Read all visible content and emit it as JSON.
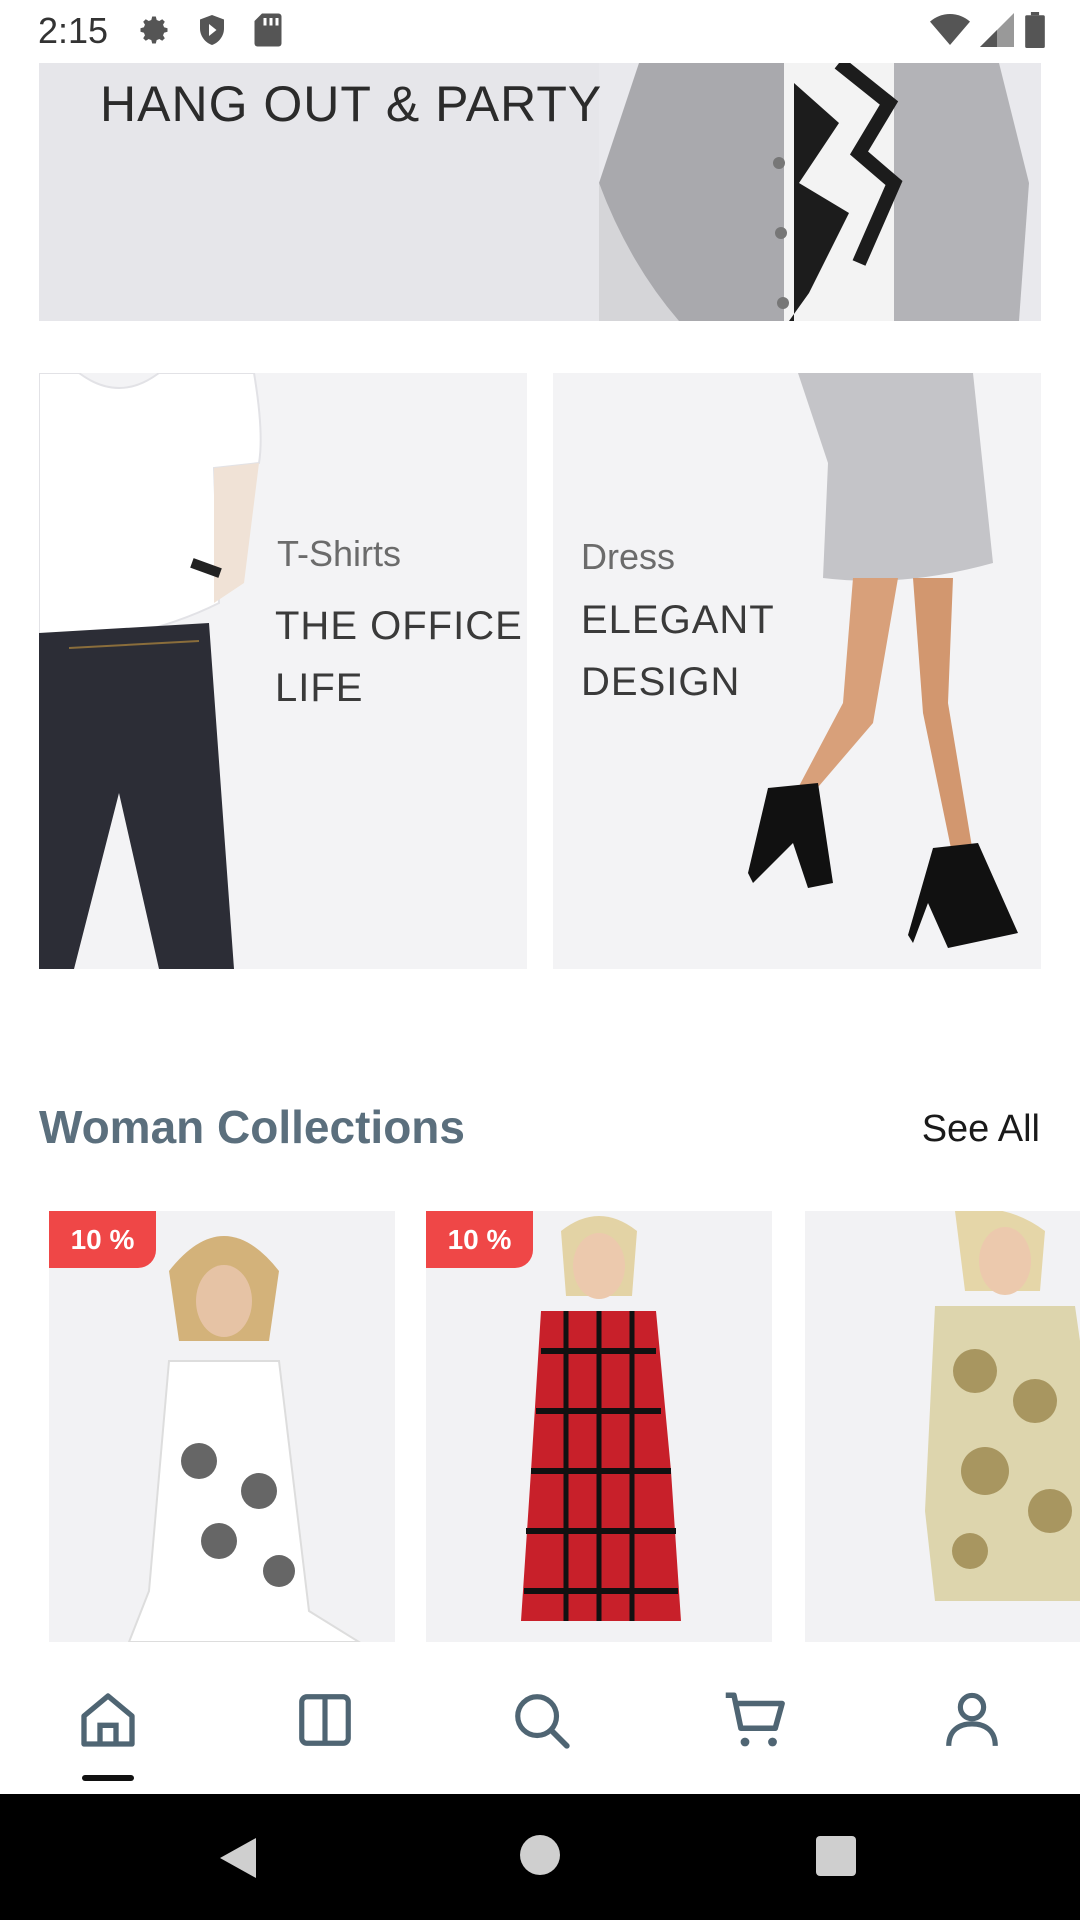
{
  "status_bar": {
    "time": "2:15",
    "left_icons": [
      "gear-icon",
      "shield-icon",
      "sd-card-icon"
    ],
    "right_icons": [
      "wifi-icon",
      "cell-signal-icon",
      "battery-icon"
    ]
  },
  "hero": {
    "title": "HANG OUT & PARTY"
  },
  "categories": [
    {
      "subtitle": "T-Shirts",
      "title_line1": "THE OFFICE",
      "title_line2": "LIFE"
    },
    {
      "subtitle": "Dress",
      "title_line1": "ELEGANT",
      "title_line2": "DESIGN"
    }
  ],
  "collection": {
    "title": "Woman Collections",
    "see_all": "See All",
    "products": [
      {
        "badge": "10 %"
      },
      {
        "badge": "10 %"
      },
      {
        "badge": ""
      }
    ]
  },
  "bottom_nav": {
    "items": [
      "home-icon",
      "catalog-icon",
      "search-icon",
      "cart-icon",
      "profile-icon"
    ],
    "active": "home-icon"
  },
  "system_nav": {
    "items": [
      "back-icon",
      "home-circle-icon",
      "recents-icon"
    ]
  },
  "colors": {
    "accent": "#5b6f7d",
    "badge": "#ef4747",
    "nav_icon": "#4f6573"
  }
}
